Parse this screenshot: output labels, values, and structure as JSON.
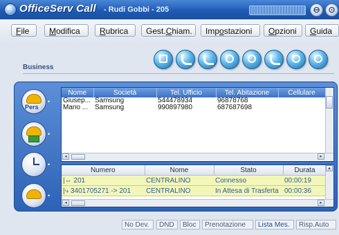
{
  "window": {
    "app_name": "OfficeServ Call",
    "user": "- Rudi Gobbi - 205",
    "minimize_glyph": "⊖",
    "close_glyph": "⊙"
  },
  "menu": {
    "items": [
      {
        "pre": "",
        "key": "F",
        "post": "ile"
      },
      {
        "pre": "",
        "key": "M",
        "post": "odifica"
      },
      {
        "pre": "",
        "key": "R",
        "post": "ubrica"
      },
      {
        "pre": "Gest.",
        "key": "C",
        "post": "hiam."
      },
      {
        "pre": "Imp",
        "key": "o",
        "post": "stazioni"
      },
      {
        "pre": "",
        "key": "O",
        "post": "pzioni"
      },
      {
        "pre": "",
        "key": "G",
        "post": "uida"
      }
    ]
  },
  "section": {
    "title": "Business"
  },
  "toolbar": {
    "icons": [
      "phonebook-icon",
      "dial-icon",
      "transfer-icon",
      "forward-icon",
      "conference-icon",
      "edit-contact-icon",
      "settings-icon",
      "info-icon"
    ]
  },
  "sidebar": {
    "buttons": [
      {
        "name": "personal-contacts",
        "label": "Pers"
      },
      {
        "name": "business-contacts",
        "label": ""
      },
      {
        "name": "call-history",
        "label": ""
      },
      {
        "name": "active-calls",
        "label": ""
      }
    ]
  },
  "contacts_table": {
    "columns": [
      "Nome",
      "Società",
      "Tel. Ufficio",
      "Tel. Abitazione",
      "Cellulare"
    ],
    "rows": [
      [
        "Giusep...",
        "Samsung",
        "544478934",
        "96878768",
        ""
      ],
      [
        "Mario ...",
        "Samsung",
        "990897980",
        "687687698",
        ""
      ]
    ]
  },
  "calls_table": {
    "columns": [
      "Numero",
      "Nome",
      "Stato",
      "Durata"
    ],
    "rows": [
      [
        "201",
        "CENTRALINO",
        "Connesso",
        "00:00:19"
      ],
      [
        "3401705271 -> 201",
        "CENTRALINO",
        "In Attesa di Trasferta",
        "00:00:36"
      ]
    ]
  },
  "status": {
    "items": [
      "No Dev.",
      "DND",
      "Bloc",
      "Prenotazione",
      "Lista Mes.",
      "Risp.Auto"
    ]
  },
  "colors": {
    "title_bar": "#1f5bb5",
    "panel": "#3b72c4",
    "call_row": "#f2f7b9"
  }
}
